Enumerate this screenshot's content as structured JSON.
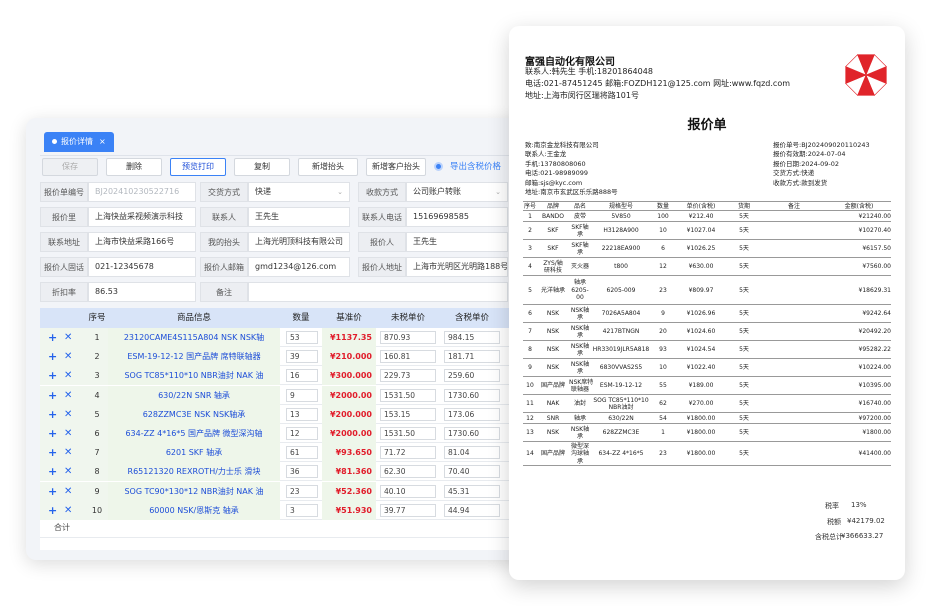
{
  "editor": {
    "tab_label": "报价详情",
    "toolbar": {
      "save": "保存",
      "delete": "删除",
      "preview": "预览打印",
      "copy": "复制",
      "add_header": "新增抬头",
      "add_customer_header": "新增客户抬头",
      "export_tax": "导出含税价格"
    },
    "form": {
      "quote_no_label": "报价单编号",
      "quote_no_value": "BJ202410230522716",
      "trade_label": "交货方式",
      "trade_value": "快递",
      "payment_label": "收款方式",
      "payment_value": "公司账户转账",
      "quoter_label": "报价里",
      "quoter_value": "上海快益采视频演示科技",
      "contact_label": "联系人",
      "contact_value": "王先生",
      "contact_phone_label": "联系人电话",
      "contact_phone_value": "15169698585",
      "address_label": "联系地址",
      "address_value": "上海市快益采路166号",
      "my_header_label": "我的抬头",
      "my_header_value": "上海光明顶科技有限公司",
      "quoter2_label": "报价人",
      "quoter2_value": "王先生",
      "quoter_tel_label": "报价人固话",
      "quoter_tel_value": "021-12345678",
      "quoter_email_label": "报价人邮箱",
      "quoter_email_value": "gmd1234@126.com",
      "quoter_addr_label": "报价人地址",
      "quoter_addr_value": "上海市光明区光明路188号",
      "discount_label": "折扣率",
      "discount_value": "86.53",
      "remark_label": "备注"
    },
    "grid": {
      "headers": [
        "序号",
        "商品信息",
        "数量",
        "基准价",
        "未税单价",
        "含税单价"
      ],
      "sum_label": "合计",
      "rows": [
        {
          "no": "1",
          "name": "23120CAME4S115A804 NSK NSK轴",
          "qty": "53",
          "base": "¥1137.35",
          "net": "870.93",
          "gross": "984.15"
        },
        {
          "no": "2",
          "name": "ESM-19-12-12 国产品牌 席特联轴器",
          "qty": "39",
          "base": "¥210.000",
          "net": "160.81",
          "gross": "181.71"
        },
        {
          "no": "3",
          "name": "SOG TC85*110*10 NBR油封 NAK 油",
          "qty": "16",
          "base": "¥300.000",
          "net": "229.73",
          "gross": "259.60"
        },
        {
          "no": "4",
          "name": "630/22N SNR 轴承",
          "qty": "9",
          "base": "¥2000.00",
          "net": "1531.50",
          "gross": "1730.60"
        },
        {
          "no": "5",
          "name": "628ZZMC3E NSK NSK轴承",
          "qty": "13",
          "base": "¥200.000",
          "net": "153.15",
          "gross": "173.06"
        },
        {
          "no": "6",
          "name": "634-ZZ 4*16*5 国产品牌 微型深沟轴",
          "qty": "12",
          "base": "¥2000.00",
          "net": "1531.50",
          "gross": "1730.60"
        },
        {
          "no": "7",
          "name": "6201 SKF 轴承",
          "qty": "61",
          "base": "¥93.650",
          "net": "71.72",
          "gross": "81.04"
        },
        {
          "no": "8",
          "name": "R65121320 REXROTH/力士乐 滑块",
          "qty": "36",
          "base": "¥81.360",
          "net": "62.30",
          "gross": "70.40"
        },
        {
          "no": "9",
          "name": "SOG TC90*130*12 NBR油封 NAK 油",
          "qty": "23",
          "base": "¥52.360",
          "net": "40.10",
          "gross": "45.31"
        },
        {
          "no": "10",
          "name": "60000 NSK/恩斯克 轴承",
          "qty": "3",
          "base": "¥51.930",
          "net": "39.77",
          "gross": "44.94"
        }
      ]
    }
  },
  "paper": {
    "company": "富强自动化有限公司",
    "contact_line": "联系人:韩先生      手机:18201864048",
    "phone_line": "电话:021-87451245      邮箱:FOZDH121@125.com      网址:www.fqzd.com",
    "address_line": "地址:上海市闵行区瑞将路101号",
    "title": "报价单",
    "customer": [
      "致:南京金龙科技有限公司",
      "联系人:王金龙",
      "手机:13780808060",
      "电话:021-98989099",
      "邮箱:sjs@kyc.com",
      "地址:南京市玄武区乐乐路888号"
    ],
    "meta": [
      "报价单号:BJ202409020110243",
      "报价有效期:2024-07-04",
      "报价日期:2024-09-02",
      "交货方式:快递",
      "收款方式:款到发货"
    ],
    "table_headers": [
      "序号",
      "品牌",
      "品名",
      "规格型号",
      "数量",
      "单价(含税)",
      "货期",
      "备注",
      "金额(含税)"
    ],
    "rows": [
      {
        "no": "1",
        "brand": "BANDO",
        "name": "皮带",
        "spec": "5V850",
        "qty": "100",
        "price": "¥212.40",
        "lead": "5天",
        "amount": "¥21240.00"
      },
      {
        "no": "2",
        "brand": "SKF",
        "name": "SKF轴\n承",
        "spec": "H3128A900",
        "qty": "10",
        "price": "¥1027.04",
        "lead": "5天",
        "amount": "¥10270.40"
      },
      {
        "no": "3",
        "brand": "SKF",
        "name": "SKF轴\n承",
        "spec": "22218EA900",
        "qty": "6",
        "price": "¥1026.25",
        "lead": "5天",
        "amount": "¥6157.50"
      },
      {
        "no": "4",
        "brand": "ZYS/轴\n研科技",
        "name": "灭火器",
        "spec": "t800",
        "qty": "12",
        "price": "¥630.00",
        "lead": "5天",
        "amount": "¥7560.00"
      },
      {
        "no": "5",
        "brand": "光洋轴承",
        "name": "轴承\n6205-\n00",
        "spec": "6205-009",
        "qty": "23",
        "price": "¥809.97",
        "lead": "5天",
        "amount": "¥18629.31"
      },
      {
        "no": "6",
        "brand": "NSK",
        "name": "NSK轴\n承",
        "spec": "7026A5A804",
        "qty": "9",
        "price": "¥1026.96",
        "lead": "5天",
        "amount": "¥9242.64"
      },
      {
        "no": "7",
        "brand": "NSK",
        "name": "NSK轴\n承",
        "spec": "4217BTNGN",
        "qty": "20",
        "price": "¥1024.60",
        "lead": "5天",
        "amount": "¥20492.20"
      },
      {
        "no": "8",
        "brand": "NSK",
        "name": "NSK轴\n承",
        "spec": "HR33019JLR5A818",
        "qty": "93",
        "price": "¥1024.54",
        "lead": "5天",
        "amount": "¥95282.22"
      },
      {
        "no": "9",
        "brand": "NSK",
        "name": "NSK轴\n承",
        "spec": "6830VVAS2S5",
        "qty": "10",
        "price": "¥1022.40",
        "lead": "5天",
        "amount": "¥10224.00"
      },
      {
        "no": "10",
        "brand": "国产品牌",
        "name": "NSK席特\n联轴器",
        "spec": "ESM-19-12-12",
        "qty": "55",
        "price": "¥189.00",
        "lead": "5天",
        "amount": "¥10395.00"
      },
      {
        "no": "11",
        "brand": "NAK",
        "name": "油封",
        "spec": "SOG TC85*110*10\nNBR油封",
        "qty": "62",
        "price": "¥270.00",
        "lead": "5天",
        "amount": "¥16740.00"
      },
      {
        "no": "12",
        "brand": "SNR",
        "name": "轴承",
        "spec": "630/22N",
        "qty": "54",
        "price": "¥1800.00",
        "lead": "5天",
        "amount": "¥97200.00"
      },
      {
        "no": "13",
        "brand": "NSK",
        "name": "NSK轴\n承",
        "spec": "628ZZMC3E",
        "qty": "1",
        "price": "¥1800.00",
        "lead": "5天",
        "amount": "¥1800.00"
      },
      {
        "no": "14",
        "brand": "国产品牌",
        "name": "微型深\n沟球轴\n承",
        "spec": "634-ZZ 4*16*5",
        "qty": "23",
        "price": "¥1800.00",
        "lead": "5天",
        "amount": "¥41400.00"
      }
    ],
    "tax_rate_label": "税率",
    "tax_rate_value": "13%",
    "tax_label": "税额",
    "tax_value": "¥42179.02",
    "total_label": "含税总计",
    "total_value": "¥366633.27",
    "colors": {
      "logo_red": "#e0242a",
      "accent": "#3b82f6"
    }
  }
}
